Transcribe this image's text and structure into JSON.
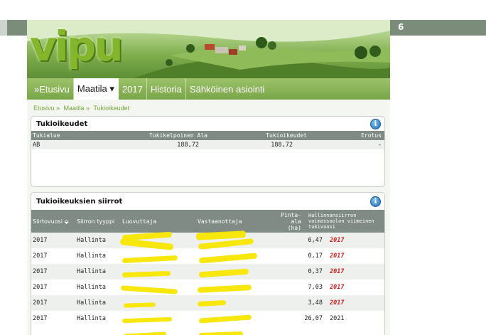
{
  "page_badge": "6",
  "logo": "vipu",
  "nav": {
    "items": [
      {
        "label": "»Etusivu",
        "active": false
      },
      {
        "label": "Maatila ▾",
        "active": true
      },
      {
        "label": "2017",
        "active": false
      },
      {
        "label": "Historia",
        "active": false
      },
      {
        "label": "Sähköinen asiointi",
        "active": false
      }
    ]
  },
  "breadcrumb": [
    "Etusivu »",
    "Maatila »",
    "Tukioikeudet"
  ],
  "panel1": {
    "title": "Tukioikeudet",
    "columns": [
      "Tukialue",
      "Tukikelpoinen Ala",
      "Tukioikeudet",
      "Erotus"
    ],
    "rows": [
      {
        "alue": "AB",
        "ala": "188,72",
        "oikeudet": "188,72",
        "erotus": "-"
      }
    ]
  },
  "panel2": {
    "title": "Tukioikeuksien siirrot",
    "columns": [
      "Siirtovuosi",
      "Siirron tyyppi",
      "Luovuttaja",
      "Vastaanottaja",
      "Pinta-ala (ha)",
      "Hallinnansiirron voimassaolon viimeinen tukivuosi"
    ],
    "sort_marker": "⬙",
    "rows": [
      {
        "vuosi": "2017",
        "tyyppi": "Hallinta",
        "ala": "6,47",
        "viimeinen": "2017",
        "highlight": true
      },
      {
        "vuosi": "2017",
        "tyyppi": "Hallinta",
        "ala": "0,17",
        "viimeinen": "2017",
        "highlight": true
      },
      {
        "vuosi": "2017",
        "tyyppi": "Hallinta",
        "ala": "0,37",
        "viimeinen": "2017",
        "highlight": true
      },
      {
        "vuosi": "2017",
        "tyyppi": "Hallinta",
        "ala": "7,03",
        "viimeinen": "2017",
        "highlight": true
      },
      {
        "vuosi": "2017",
        "tyyppi": "Hallinta",
        "ala": "3,48",
        "viimeinen": "2017",
        "highlight": true
      },
      {
        "vuosi": "2017",
        "tyyppi": "Hallinta",
        "ala": "26,07",
        "viimeinen": "2021",
        "highlight": false
      }
    ]
  },
  "colors": {
    "nav_green": "#7aa548",
    "header_gray": "#7f8b84",
    "highlight_red": "#d11e1e",
    "redaction_yellow": "#f7e600"
  },
  "icons": [
    "info-icon",
    "sort-icon"
  ]
}
